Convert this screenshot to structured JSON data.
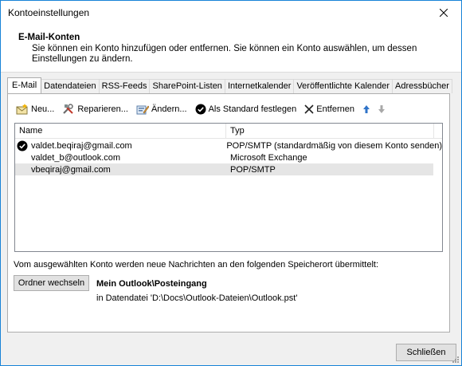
{
  "window": {
    "title": "Kontoeinstellungen"
  },
  "header": {
    "title": "E-Mail-Konten",
    "description": "Sie können ein Konto hinzufügen oder entfernen. Sie können ein Konto auswählen, um dessen Einstellungen zu ändern."
  },
  "tabs": [
    {
      "label": "E-Mail",
      "active": true
    },
    {
      "label": "Datendateien",
      "active": false
    },
    {
      "label": "RSS-Feeds",
      "active": false
    },
    {
      "label": "SharePoint-Listen",
      "active": false
    },
    {
      "label": "Internetkalender",
      "active": false
    },
    {
      "label": "Veröffentlichte Kalender",
      "active": false
    },
    {
      "label": "Adressbücher",
      "active": false
    }
  ],
  "toolbar": {
    "new_label": "Neu...",
    "repair_label": "Reparieren...",
    "change_label": "Ändern...",
    "default_label": "Als Standard festlegen",
    "remove_label": "Entfernen"
  },
  "list": {
    "columns": [
      "Name",
      "Typ"
    ],
    "rows": [
      {
        "name": "valdet.beqiraj@gmail.com",
        "type": "POP/SMTP (standardmäßig von diesem Konto senden)",
        "default": true,
        "selected": false
      },
      {
        "name": "valdet_b@outlook.com",
        "type": "Microsoft Exchange",
        "default": false,
        "selected": false
      },
      {
        "name": "vbeqiraj@gmail.com",
        "type": "POP/SMTP",
        "default": false,
        "selected": true
      }
    ]
  },
  "delivery": {
    "info": "Vom ausgewählten Konto werden neue Nachrichten an den folgenden Speicherort übermittelt:",
    "change_folder_label": "Ordner wechseln",
    "folder_name": "Mein Outlook\\Posteingang",
    "folder_path": "in Datendatei 'D:\\Docs\\Outlook-Dateien\\Outlook.pst'"
  },
  "footer": {
    "close_label": "Schließen"
  }
}
